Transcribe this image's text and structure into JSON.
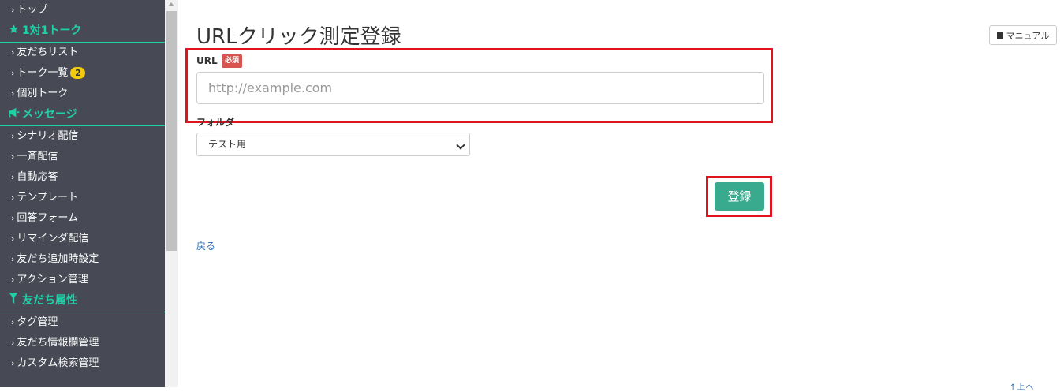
{
  "sidebar": {
    "sections": [
      {
        "type": "item",
        "label": "トップ"
      },
      {
        "type": "heading",
        "icon": "star-icon",
        "label": "1対1トーク"
      },
      {
        "type": "item",
        "label": "友だちリスト"
      },
      {
        "type": "item",
        "label": "トーク一覧",
        "badge": "2"
      },
      {
        "type": "item",
        "label": "個別トーク"
      },
      {
        "type": "heading",
        "icon": "megaphone-icon",
        "label": "メッセージ"
      },
      {
        "type": "item",
        "label": "シナリオ配信"
      },
      {
        "type": "item",
        "label": "一斉配信"
      },
      {
        "type": "item",
        "label": "自動応答"
      },
      {
        "type": "item",
        "label": "テンプレート"
      },
      {
        "type": "item",
        "label": "回答フォーム"
      },
      {
        "type": "item",
        "label": "リマインダ配信"
      },
      {
        "type": "item",
        "label": "友だち追加時設定"
      },
      {
        "type": "item",
        "label": "アクション管理"
      },
      {
        "type": "heading",
        "icon": "filter-icon",
        "label": "友だち属性"
      },
      {
        "type": "item",
        "label": "タグ管理"
      },
      {
        "type": "item",
        "label": "友だち情報欄管理"
      },
      {
        "type": "item",
        "label": "カスタム検索管理"
      }
    ],
    "chevron": "›"
  },
  "main": {
    "title": "URLクリック測定登録",
    "manual_label": "マニュアル",
    "url_label": "URL",
    "required_label": "必須",
    "url_placeholder": "http://example.com",
    "url_value": "",
    "folder_label": "フォルダ",
    "folder_selected": "テスト用",
    "submit_label": "登録",
    "back_label": "戻る",
    "corner_fragment": "↑上へ"
  },
  "colors": {
    "sidebar_bg": "#474a55",
    "accent_green": "#1fd0a7",
    "submit_green": "#3aaa8e",
    "highlight_red": "#e0141e",
    "required_red": "#d9534f",
    "badge_yellow": "#f2cc0c",
    "link_blue": "#2a6ebb"
  }
}
